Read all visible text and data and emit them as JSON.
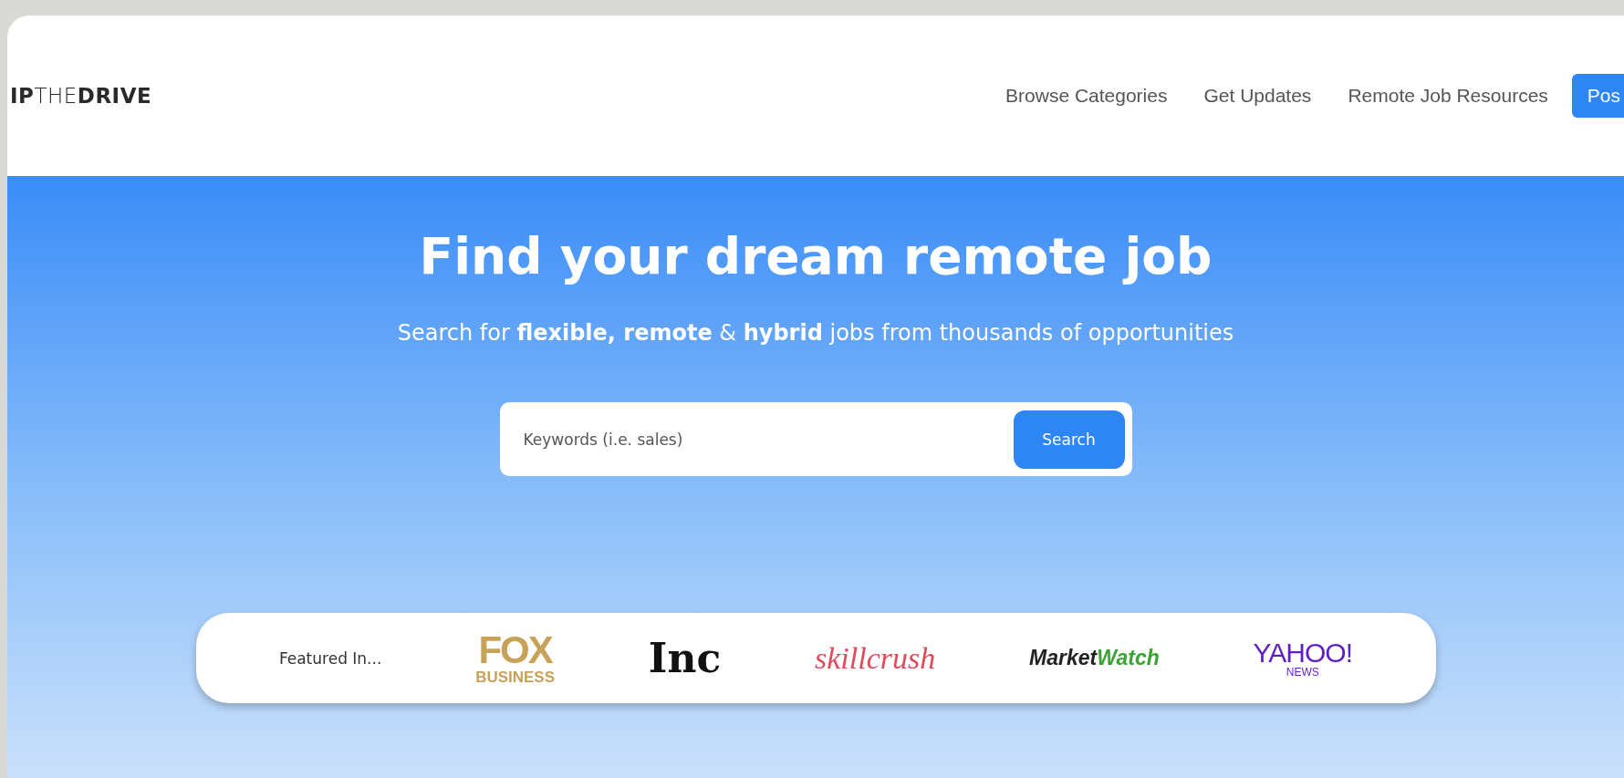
{
  "header": {
    "logo": "**IP**THE**DRIVE**",
    "nav": [
      "Browse Categories",
      "Get Updates",
      "Remote Job Resources"
    ],
    "post_button": "Pos"
  },
  "hero": {
    "title": "Find your dream remote job",
    "subtitle": "Search for **flexible, remote** & **hybrid** jobs from thousands of opportunities",
    "search": {
      "placeholder": "Keywords (i.e. sales)",
      "button": "Search"
    }
  },
  "featured": {
    "label": "Featured In...",
    "logos": [
      {
        "kind": "fox",
        "text": "FOX",
        "subtext": "BUSINESS"
      },
      {
        "kind": "inc",
        "text": "Inc"
      },
      {
        "kind": "skillcrush",
        "text": "skillcrush"
      },
      {
        "kind": "marketwatch",
        "text": "Market",
        "subtext": "Watch"
      },
      {
        "kind": "yahoo",
        "text": "YAHOO!",
        "subtext": "NEWS"
      }
    ]
  }
}
